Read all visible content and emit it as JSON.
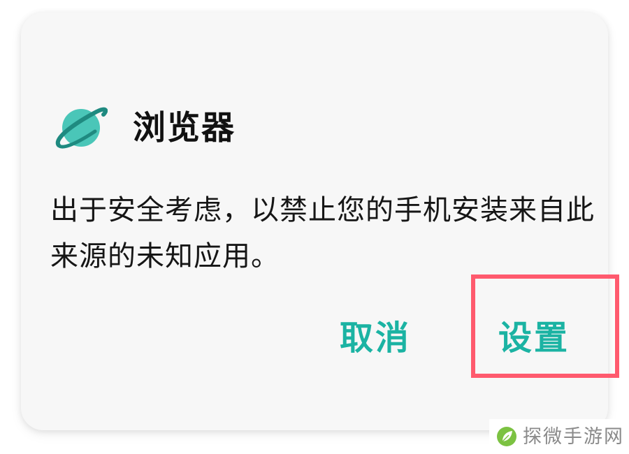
{
  "dialog": {
    "app_icon": "planet-icon",
    "app_name": "浏览器",
    "message": "出于安全考虑，以禁止您的手机安装来自此来源的未知应用。",
    "buttons": {
      "cancel_label": "取消",
      "settings_label": "设置"
    }
  },
  "highlight": {
    "target": "settings-button",
    "color": "#ff5a6e"
  },
  "watermark": {
    "logo": "leaf-logo-icon",
    "text": "探微手游网"
  },
  "colors": {
    "accent": "#1bb3a3",
    "icon_planet": "#4ac6b8",
    "icon_ring": "#1f8a80",
    "dialog_bg": "#f7f7f7"
  }
}
